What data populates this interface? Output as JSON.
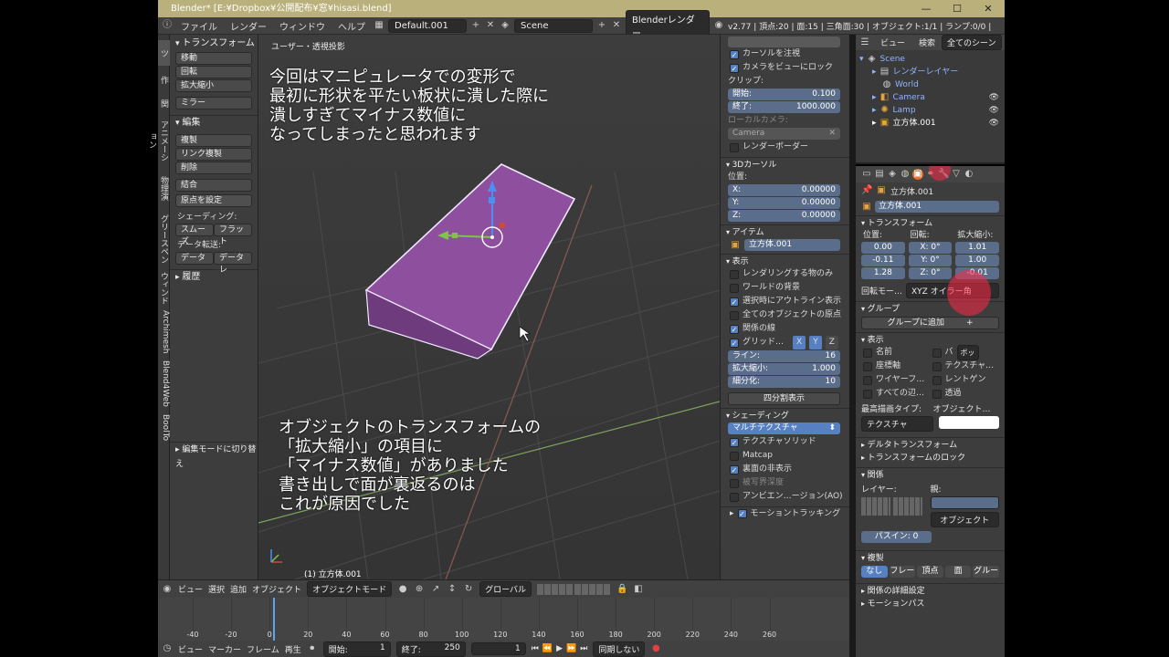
{
  "window": {
    "title": "Blender* [E:¥Dropbox¥公開配布¥窓¥hisasi.blend]",
    "minimize": "—",
    "maximize": "☐",
    "close": "✕"
  },
  "menubar": {
    "items": [
      "ファイル",
      "レンダー",
      "ウィンドウ",
      "ヘルプ"
    ],
    "layout": "Default.001",
    "scene": "Scene",
    "engine": "Blenderレンダー",
    "stats": "v2.77 | 頂点:20 | 面:15 | 三角面:30 | オブジェクト:1/1 | ランプ:0/0 |"
  },
  "left_tabs": [
    "ツ",
    "作",
    "関",
    "アニメーション",
    "物理演",
    "グリースペン",
    "ウィンド",
    "Archimesh",
    "Blend4Web",
    "BoolTo"
  ],
  "tool_panel": {
    "transform": {
      "header": "トランスフォーム",
      "buttons": [
        "移動",
        "回転",
        "拡大縮小",
        "ミラー"
      ]
    },
    "edit": {
      "header": "編集",
      "buttons": [
        "複製",
        "リンク複製",
        "削除",
        "結合"
      ],
      "origin": "原点を設定",
      "shading_label": "シェーディング:",
      "smooth": "スムーズ",
      "flat": "フラット",
      "data_transfer_label": "データ転送:",
      "data": "データ",
      "data_layout": "データレ"
    },
    "history": "履歴",
    "edit_mode_toggle": "編集モードに切り替え"
  },
  "viewport": {
    "view_label": "ユーザー・透視投影",
    "object_label": "(1) 立方体.001",
    "annotation_top": [
      "今回はマニピュレータでの変形で",
      "最初に形状を平たい板状に潰した際に",
      "潰しすぎてマイナス数値に",
      "なってしまったと思われます"
    ],
    "annotation_bottom": [
      "オブジェクトのトランスフォームの",
      "「拡大縮小」の項目に",
      "「マイナス数値」がありました",
      "書き出しで面が裏返るのは",
      "これが原因でした"
    ]
  },
  "n_panel": {
    "lock_cursor": "カーソルを注視",
    "lock_camera": "カメラをビューにロック",
    "clip_label": "クリップ:",
    "clip_start_label": "開始:",
    "clip_start": "0.100",
    "clip_end_label": "終了:",
    "clip_end": "1000.000",
    "local_camera_label": "ローカルカメラ:",
    "local_camera": "Camera",
    "render_border": "レンダーボーダー",
    "cursor_header": "3Dカーソル",
    "location_label": "位置:",
    "cursor_x_label": "X:",
    "cursor_x": "0.00000",
    "cursor_y_label": "Y:",
    "cursor_y": "0.00000",
    "cursor_z_label": "Z:",
    "cursor_z": "0.00000",
    "item_header": "アイテム",
    "item_name": "立方体.001",
    "display_header": "表示",
    "display_opts": [
      {
        "label": "レンダリングする物のみ",
        "on": false
      },
      {
        "label": "ワールドの背景",
        "on": false
      },
      {
        "label": "選択時にアウトライン表示",
        "on": true
      },
      {
        "label": "全てのオブジェクトの原点",
        "on": false
      },
      {
        "label": "関係の線",
        "on": true
      }
    ],
    "grid_floor": "グリッド…",
    "axes": [
      "X",
      "Y",
      "Z"
    ],
    "lines_label": "ライン:",
    "lines": "16",
    "scale_label": "拡大縮小:",
    "scale": "1.000",
    "subdiv_label": "細分化:",
    "subdiv": "10",
    "quad_view": "四分割表示",
    "shading_header": "シェーディング",
    "shading_mode": "マルチテクスチャ",
    "shading_opts": [
      {
        "label": "テクスチャソリッド",
        "on": true
      },
      {
        "label": "Matcap",
        "on": false
      },
      {
        "label": "裏面の非表示",
        "on": true
      },
      {
        "label": "被写界深度",
        "on": false
      },
      {
        "label": "アンビエン…ージョン(AO)",
        "on": false
      }
    ],
    "motion_tracking": "モーショントラッキング"
  },
  "outliner": {
    "view": "ビュー",
    "search": "検索",
    "scope": "全てのシーン",
    "items": [
      "Scene",
      "レンダーレイヤー",
      "World",
      "Camera",
      "Lamp",
      "立方体.001"
    ]
  },
  "properties": {
    "object_name": "立方体.001",
    "object_field": "立方体.001",
    "transform_header": "トランスフォーム",
    "loc_label": "位置:",
    "rot_label": "回転:",
    "scale_label": "拡大縮小:",
    "loc": [
      "0.00",
      "-0.11",
      "1.28"
    ],
    "rot": [
      "X: 0°",
      "Y: 0°",
      "Z: 0°"
    ],
    "scale": [
      "1.01",
      "1.00",
      "-0.01"
    ],
    "rot_mode_label": "回転モー…",
    "rot_mode": "XYZ オイラー角",
    "group_header": "グループ",
    "add_group": "グループに追加",
    "display_header": "表示",
    "display_left": [
      "名前",
      "座標軸",
      "ワイヤーフ…",
      "すべての辺…"
    ],
    "display_right": [
      "バ",
      "テクスチャ…",
      "レントゲン",
      "透過"
    ],
    "bounds_type": "ボッ",
    "max_draw_label": "最高描画タイプ:",
    "max_draw": "テクスチャ",
    "obj_color_label": "オブジェクト…",
    "delta_transform": "デルタトランスフォーム",
    "transform_lock": "トランスフォームのロック",
    "relations_header": "関係",
    "layer_label": "レイヤー:",
    "parent_label": "親:",
    "parent_type": "オブジェクト",
    "pass_index": "パスイン: 0",
    "duplication_header": "複製",
    "dup_options": [
      "なし",
      "フレー",
      "頂点",
      "面",
      "グルー"
    ],
    "relations_extra": "関係の詳細設定",
    "motion_paths": "モーションパス"
  },
  "timeline": {
    "header_items": [
      "ビュー",
      "選択",
      "追加",
      "オブジェクト"
    ],
    "mode": "オブジェクトモード",
    "orientation": "グローバル",
    "ticks": [
      "-40",
      "-20",
      "0",
      "20",
      "40",
      "60",
      "80",
      "100",
      "120",
      "140",
      "160",
      "180",
      "200",
      "220",
      "240",
      "260"
    ],
    "footer_items": [
      "ビュー",
      "マーカー",
      "フレーム",
      "再生"
    ],
    "start_label": "開始:",
    "start": "1",
    "end_label": "終了:",
    "end": "250",
    "current": "1",
    "sync": "同期しない"
  },
  "colors": {
    "object": "#8e4f9e",
    "object_dark": "#6e3b7c",
    "highlight": "#ff2846"
  }
}
